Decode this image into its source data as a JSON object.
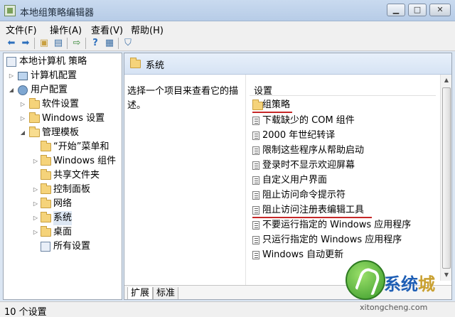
{
  "window": {
    "title": "本地组策略编辑器",
    "controls": [
      "minimize-icon",
      "maximize-icon",
      "close-icon"
    ]
  },
  "menubar": {
    "items": [
      "文件(F)",
      "操作(A)",
      "查看(V)",
      "帮助(H)"
    ]
  },
  "toolbar": {
    "icons": [
      "back-arrow-icon",
      "forward-arrow-icon",
      "up-folder-icon",
      "show-tree-icon",
      "export-icon",
      "help-icon",
      "properties-icon",
      "filter-icon"
    ]
  },
  "tree": {
    "items": [
      {
        "label": "本地计算机 策略",
        "icon": "policy-icon",
        "expanded": true
      },
      {
        "label": "计算机配置",
        "icon": "computer-icon",
        "expanded": false
      },
      {
        "label": "用户配置",
        "icon": "user-icon",
        "expanded": true
      },
      {
        "label": "软件设置",
        "icon": "folder-icon",
        "expanded": false
      },
      {
        "label": "Windows 设置",
        "icon": "folder-icon",
        "expanded": false
      },
      {
        "label": "管理模板",
        "icon": "folder-icon",
        "expanded": true
      },
      {
        "label": "“开始”菜单和",
        "icon": "folder-icon",
        "expanded": false
      },
      {
        "label": "Windows 组件",
        "icon": "folder-icon",
        "expanded": false
      },
      {
        "label": "共享文件夹",
        "icon": "folder-icon",
        "expanded": false
      },
      {
        "label": "控制面板",
        "icon": "folder-icon",
        "expanded": false
      },
      {
        "label": "网络",
        "icon": "folder-icon",
        "expanded": false
      },
      {
        "label": "系统",
        "icon": "folder-icon",
        "expanded": false,
        "selected": true
      },
      {
        "label": "桌面",
        "icon": "folder-icon",
        "expanded": false
      },
      {
        "label": "所有设置",
        "icon": "settings-folder-icon",
        "expanded": false
      }
    ]
  },
  "right": {
    "header_title": "系统",
    "description": "选择一个项目来查看它的描述。",
    "column_header": "设置",
    "rows": [
      {
        "label": "组策略",
        "type": "folder",
        "highlighted": true
      },
      {
        "label": "下载缺少的 COM 组件",
        "type": "setting"
      },
      {
        "label": "2000 年世纪转译",
        "type": "setting"
      },
      {
        "label": "限制这些程序从帮助启动",
        "type": "setting"
      },
      {
        "label": "登录时不显示欢迎屏幕",
        "type": "setting"
      },
      {
        "label": "自定义用户界面",
        "type": "setting"
      },
      {
        "label": "阻止访问命令提示符",
        "type": "setting"
      },
      {
        "label": "阻止访问注册表编辑工具",
        "type": "setting",
        "highlighted": true
      },
      {
        "label": "不要运行指定的 Windows 应用程序",
        "type": "setting"
      },
      {
        "label": "只运行指定的 Windows 应用程序",
        "type": "setting"
      },
      {
        "label": "Windows 自动更新",
        "type": "setting"
      }
    ],
    "tabs": [
      "扩展",
      "标准"
    ]
  },
  "status": {
    "text": "10 个设置"
  },
  "watermark": {
    "text_part1": "系统",
    "text_part2": "城",
    "url": "xitongcheng.com"
  },
  "colors": {
    "highlight_underline": "#c62828",
    "folder": "#f5d37a",
    "title_bar": "#c9daef"
  }
}
